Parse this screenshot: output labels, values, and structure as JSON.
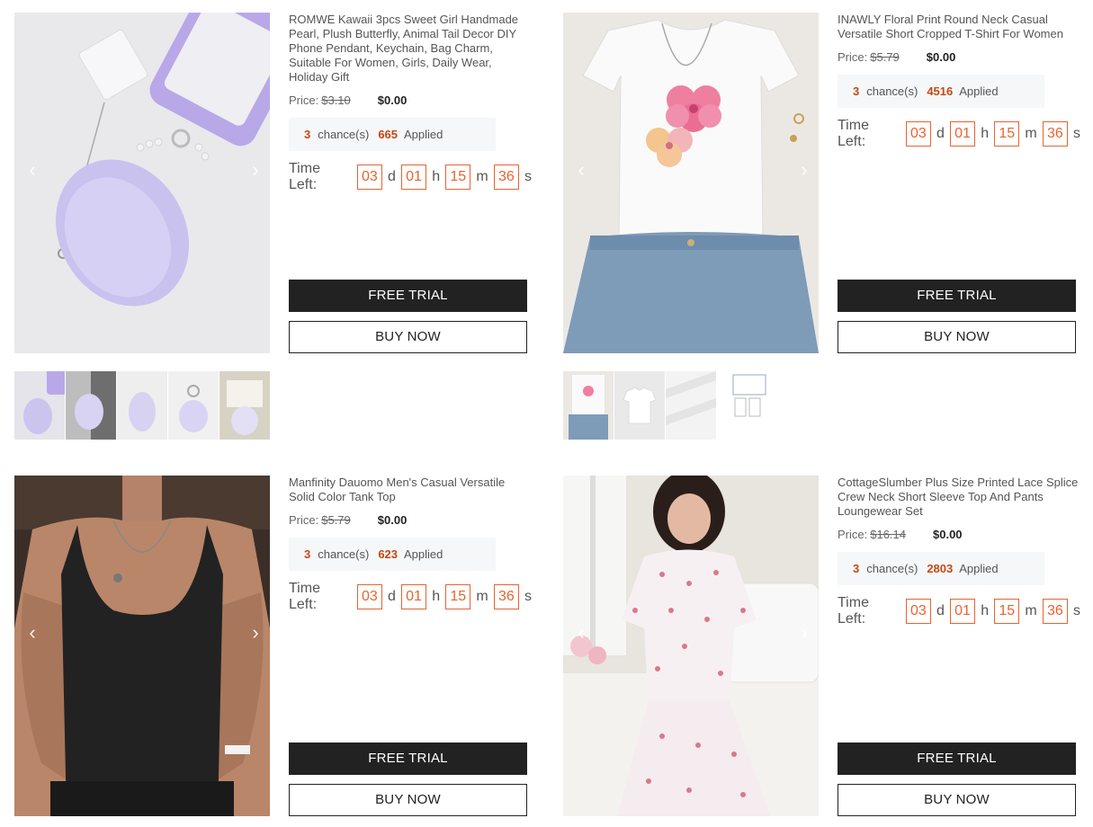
{
  "products": [
    {
      "title": "ROMWE Kawaii 3pcs Sweet Girl Handmade Pearl, Plush Butterfly, Animal Tail Decor DIY Phone Pendant, Keychain, Bag Charm, Suitable For Women, Girls, Daily Wear, Holiday Gift",
      "price_label": "Price:",
      "original_price": "$3.10",
      "current_price": "$0.00",
      "chances": "3",
      "chances_label": "chance(s)",
      "applied_count": "665",
      "applied_label": "Applied",
      "time_left_label": "Time Left:",
      "days": "03",
      "hours": "01",
      "minutes": "15",
      "seconds": "36",
      "free_trial_label": "FREE TRIAL",
      "buy_now_label": "BUY NOW"
    },
    {
      "title": "INAWLY Floral Print Round Neck Casual Versatile Short Cropped T-Shirt For Women",
      "price_label": "Price:",
      "original_price": "$5.79",
      "current_price": "$0.00",
      "chances": "3",
      "chances_label": "chance(s)",
      "applied_count": "4516",
      "applied_label": "Applied",
      "time_left_label": "Time Left:",
      "days": "03",
      "hours": "01",
      "minutes": "15",
      "seconds": "36",
      "free_trial_label": "FREE TRIAL",
      "buy_now_label": "BUY NOW"
    },
    {
      "title": "Manfinity Dauomo Men's Casual Versatile Solid Color Tank Top",
      "price_label": "Price:",
      "original_price": "$5.79",
      "current_price": "$0.00",
      "chances": "3",
      "chances_label": "chance(s)",
      "applied_count": "623",
      "applied_label": "Applied",
      "time_left_label": "Time Left:",
      "days": "03",
      "hours": "01",
      "minutes": "15",
      "seconds": "36",
      "free_trial_label": "FREE TRIAL",
      "buy_now_label": "BUY NOW"
    },
    {
      "title": "CottageSlumber Plus Size Printed Lace Splice Crew Neck Short Sleeve Top And Pants Loungewear Set",
      "price_label": "Price:",
      "original_price": "$16.14",
      "current_price": "$0.00",
      "chances": "3",
      "chances_label": "chance(s)",
      "applied_count": "2803",
      "applied_label": "Applied",
      "time_left_label": "Time Left:",
      "days": "03",
      "hours": "01",
      "minutes": "15",
      "seconds": "36",
      "free_trial_label": "FREE TRIAL",
      "buy_now_label": "BUY NOW"
    }
  ],
  "units": {
    "d": "d",
    "h": "h",
    "m": "m",
    "s": "s"
  },
  "icons": {
    "prev": "chevron-left-icon",
    "next": "chevron-right-icon"
  },
  "colors": {
    "accent": "#e8632f",
    "count": "#c24a14",
    "button_dark": "#222222"
  }
}
